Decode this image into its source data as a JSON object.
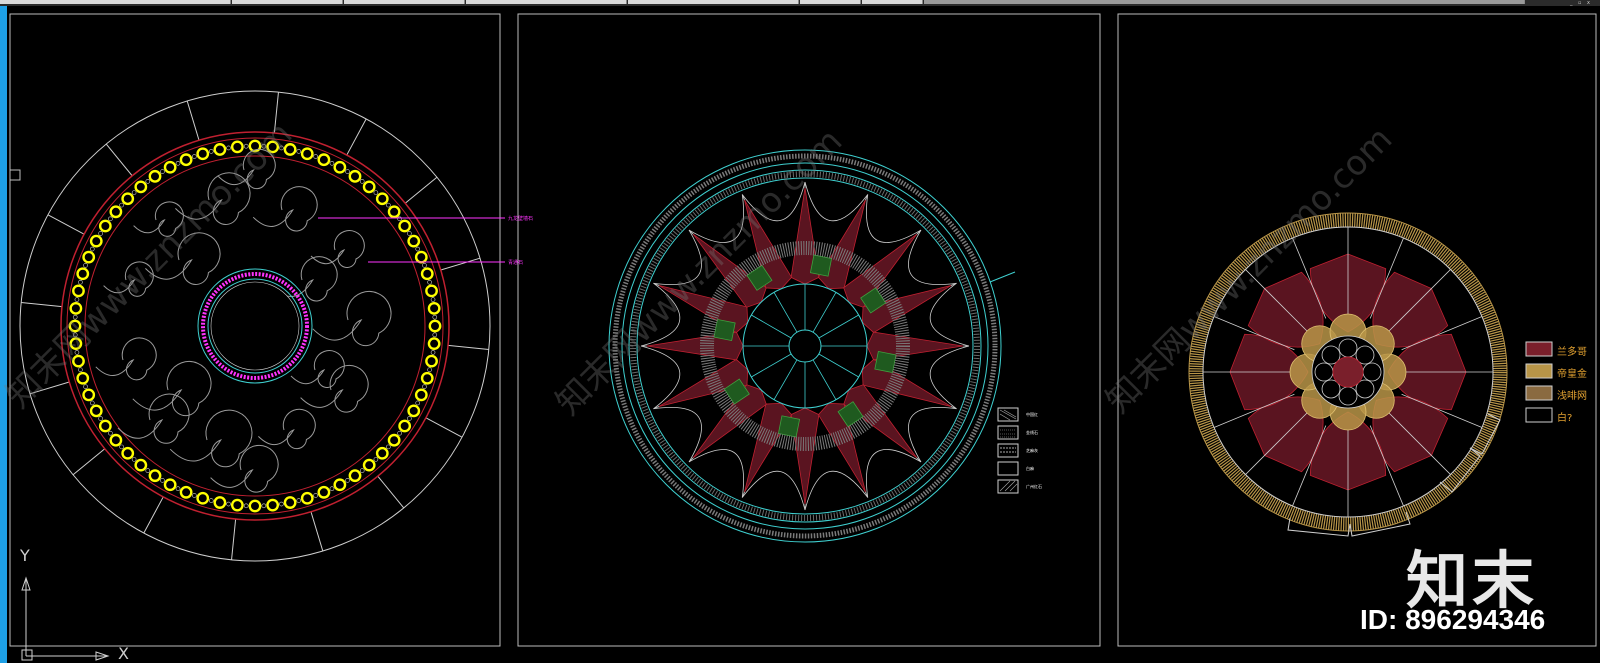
{
  "app": {
    "window_controls": "_ ▫ x"
  },
  "annotations": {
    "label_1": "九龙壁墙石",
    "label_2": "青通石"
  },
  "legend_center": [
    {
      "label": "中国红"
    },
    {
      "label": "金线石"
    },
    {
      "label": "芝麻灰"
    },
    {
      "label": "白麻"
    },
    {
      "label": "广州红石"
    }
  ],
  "legend_right": [
    {
      "label": "兰多哥",
      "swatch": "#7a1f2b"
    },
    {
      "label": "帝皇金",
      "swatch": "#b89548"
    },
    {
      "label": "浅啡网",
      "swatch": "#8a6a40"
    },
    {
      "label": "白?",
      "swatch": "#000000"
    }
  ],
  "axes": {
    "y": "Y",
    "x": "X"
  },
  "watermark": {
    "text": "知末网www.znzmo.com",
    "brand": "知末",
    "id": "ID: 896294346"
  },
  "colors": {
    "accent_blue": "#1ea0e6",
    "cad_white": "#d8d8d8",
    "cad_yellow": "#ffff00",
    "cad_magenta": "#ff33ff",
    "cad_cyan": "#3fd0d0",
    "cad_red": "#c02030",
    "cad_maroon": "#7a1f2b",
    "cad_gold": "#b89548"
  },
  "icons": [
    "ucs-axis-icon",
    "viewport-square-icon"
  ]
}
